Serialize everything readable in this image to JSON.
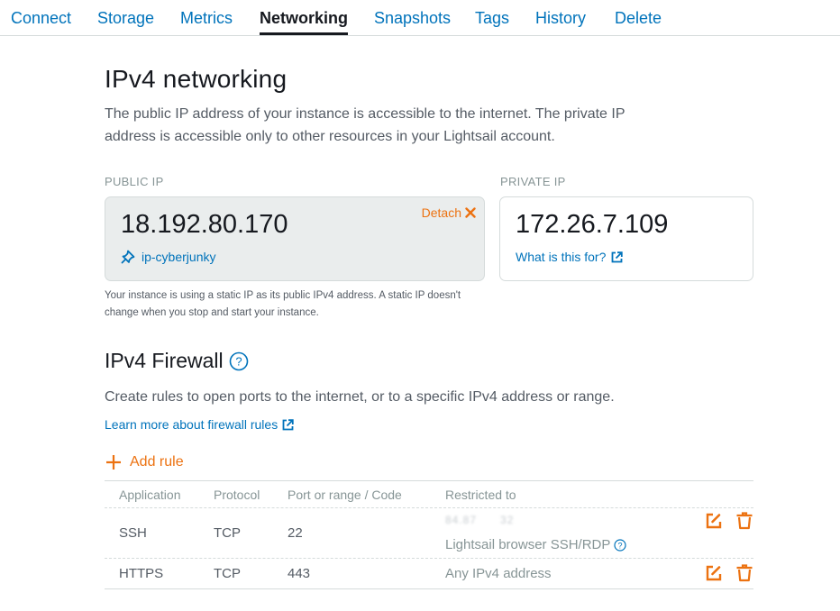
{
  "tabs": [
    {
      "label": "Connect",
      "active": false
    },
    {
      "label": "Storage",
      "active": false
    },
    {
      "label": "Metrics",
      "active": false
    },
    {
      "label": "Networking",
      "active": true
    },
    {
      "label": "Snapshots",
      "active": false
    },
    {
      "label": "Tags",
      "active": false
    },
    {
      "label": "History",
      "active": false
    },
    {
      "label": "Delete",
      "active": false
    }
  ],
  "ipv4_networking": {
    "title": "IPv4 networking",
    "description": "The public IP address of your instance is accessible to the internet. The private IP address is accessible only to other resources in your Lightsail account.",
    "public_ip": {
      "label": "PUBLIC IP",
      "address": "18.192.80.170",
      "detach_label": "Detach",
      "static_ip_name": "ip-cyberjunky",
      "static_ip_icon": "pin-icon"
    },
    "private_ip": {
      "label": "PRIVATE IP",
      "address": "172.26.7.109",
      "help_link": "What is this for?"
    },
    "static_ip_note": "Your instance is using a static IP as its public IPv4 address. A static IP doesn't change when you stop and start your instance."
  },
  "firewall": {
    "title": "IPv4 Firewall",
    "description": "Create rules to open ports to the internet, or to a specific IPv4 address or range.",
    "learn_more": "Learn more about firewall rules",
    "add_rule_label": "Add rule",
    "columns": [
      "Application",
      "Protocol",
      "Port or range / Code",
      "Restricted to"
    ],
    "rules": [
      {
        "application": "SSH",
        "protocol": "TCP",
        "port": "22",
        "restricted_to": "84.87.x.x/32 (obscured)",
        "restricted_note": "Lightsail browser SSH/RDP"
      },
      {
        "application": "HTTPS",
        "protocol": "TCP",
        "port": "443",
        "restricted_to": "Any IPv4 address"
      }
    ]
  },
  "colors": {
    "link": "#0073bb",
    "accent": "#ec7211",
    "text": "#16191f",
    "muted": "#545b64",
    "subtle": "#879596",
    "card_bg": "#eaeded",
    "border": "#d5dbdb"
  }
}
